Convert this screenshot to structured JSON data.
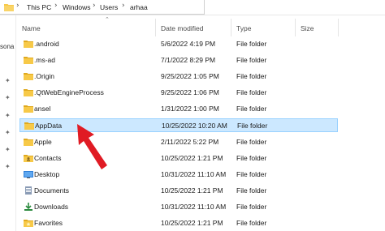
{
  "breadcrumb": {
    "items": [
      "This PC",
      "Windows",
      "Users",
      "arhaa"
    ]
  },
  "nav": {
    "clipped_label": "sona"
  },
  "columns": {
    "name": "Name",
    "date": "Date modified",
    "type": "Type",
    "size": "Size"
  },
  "rows": [
    {
      "name": ".android",
      "date": "5/6/2022 4:19 PM",
      "type": "File folder",
      "icon": "folder-icon"
    },
    {
      "name": ".ms-ad",
      "date": "7/1/2022 8:29 PM",
      "type": "File folder",
      "icon": "folder-icon"
    },
    {
      "name": ".Origin",
      "date": "9/25/2022 1:05 PM",
      "type": "File folder",
      "icon": "folder-icon"
    },
    {
      "name": ".QtWebEngineProcess",
      "date": "9/25/2022 1:06 PM",
      "type": "File folder",
      "icon": "folder-icon"
    },
    {
      "name": "ansel",
      "date": "1/31/2022 1:00 PM",
      "type": "File folder",
      "icon": "folder-icon"
    },
    {
      "name": "AppData",
      "date": "10/25/2022 10:20 AM",
      "type": "File folder",
      "icon": "folder-icon",
      "selected": true
    },
    {
      "name": "Apple",
      "date": "2/11/2022 5:22 PM",
      "type": "File folder",
      "icon": "folder-icon"
    },
    {
      "name": "Contacts",
      "date": "10/25/2022 1:21 PM",
      "type": "File folder",
      "icon": "contacts-folder-icon"
    },
    {
      "name": "Desktop",
      "date": "10/31/2022 11:10 AM",
      "type": "File folder",
      "icon": "desktop-folder-icon"
    },
    {
      "name": "Documents",
      "date": "10/25/2022 1:21 PM",
      "type": "File folder",
      "icon": "documents-folder-icon"
    },
    {
      "name": "Downloads",
      "date": "10/31/2022 11:10 AM",
      "type": "File folder",
      "icon": "downloads-folder-icon"
    },
    {
      "name": "Favorites",
      "date": "10/25/2022 1:21 PM",
      "type": "File folder",
      "icon": "favorites-folder-icon"
    }
  ],
  "colors": {
    "folder": "#f7c948",
    "folder_dark": "#e0a91e",
    "selection_bg": "#cce8ff",
    "selection_border": "#99d1ff",
    "arrow": "#e01b24"
  }
}
